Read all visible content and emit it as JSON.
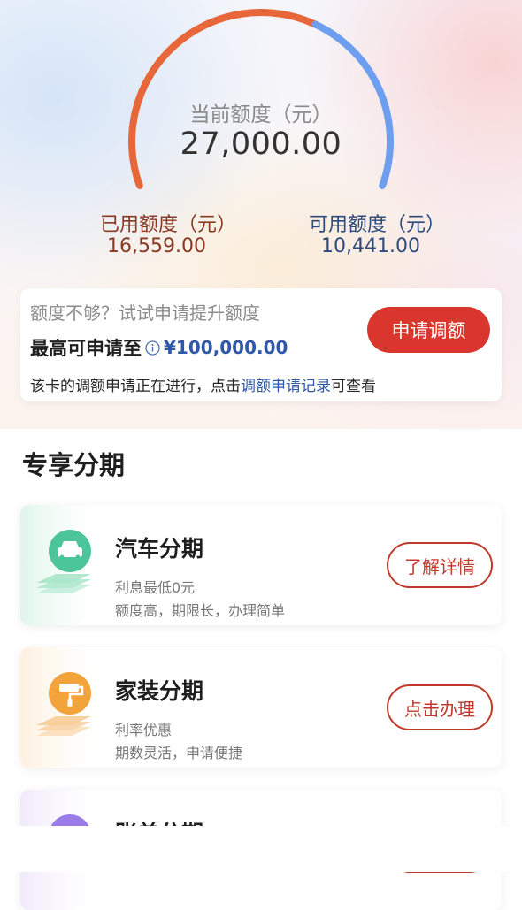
{
  "credit": {
    "title": "当前额度（元）",
    "total": "27,000.00",
    "used_fraction": 0.613,
    "used_label": "已用额度（元）",
    "used_value": "16,559.00",
    "available_label": "可用额度（元）",
    "available_value": "10,441.00"
  },
  "upgrade": {
    "hint": "额度不够？试试申请提升额度",
    "max_label": "最高可申请至",
    "max_value": "¥100,000.00",
    "apply_button": "申请调额",
    "record_prefix": "该卡的调额申请正在进行，点击",
    "record_link": "调额申请记录",
    "record_suffix": "可查看"
  },
  "installments": {
    "section_title": "专享分期",
    "cards": [
      {
        "title": "汽车分期",
        "line1": "利息最低0元",
        "line2": "额度高，期限长，办理简单",
        "button": "了解详情",
        "icon": "car-icon",
        "accent": "#3fbf8f"
      },
      {
        "title": "家装分期",
        "line1": "利率优惠",
        "line2": "期数灵活，申请便捷",
        "button": "点击办理",
        "icon": "paint-roller-icon",
        "accent": "#f2a33a"
      },
      {
        "title": "账单分期",
        "icon": "bill-icon",
        "accent": "#9a7be8"
      }
    ]
  },
  "colors": {
    "used_arc": "#e8673a",
    "available_arc": "#6d9eef",
    "primary_red": "#d9362d",
    "link_blue": "#2f58a8"
  }
}
